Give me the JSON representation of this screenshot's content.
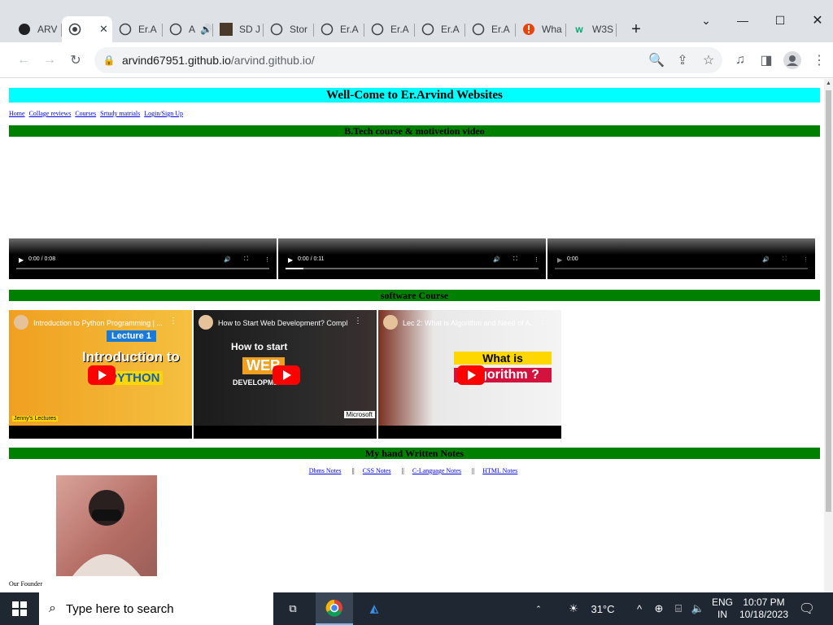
{
  "browser": {
    "tabs": [
      {
        "label": "ARV",
        "icon": "github-icon"
      },
      {
        "label": "",
        "icon": "globe-icon",
        "active": true
      },
      {
        "label": "Er.A",
        "icon": "globe-icon"
      },
      {
        "label": "A",
        "icon": "globe-icon"
      },
      {
        "label": "SD J",
        "icon": "app-icon"
      },
      {
        "label": "Stor",
        "icon": "globe-icon"
      },
      {
        "label": "Er.A",
        "icon": "globe-icon"
      },
      {
        "label": "Er.A",
        "icon": "globe-icon"
      },
      {
        "label": "Er.A",
        "icon": "globe-icon"
      },
      {
        "label": "Er.A",
        "icon": "globe-icon"
      },
      {
        "label": "Wha",
        "icon": "alert-icon"
      },
      {
        "label": "W3S",
        "icon": "w3schools-icon"
      }
    ],
    "url_host": "arvind67951.github.io",
    "url_path": "/arvind.github.io/"
  },
  "page": {
    "title": "Well-Come to Er.Arvind Websites",
    "nav": [
      "Home",
      "Collage reviews",
      "Courses",
      "Srtudy matrials",
      "Login/Sign Up"
    ],
    "section_videos": "B.Tech course & motivetion video",
    "videos": [
      {
        "time": "0:00 / 0:08",
        "progress": 0
      },
      {
        "time": "0:00 / 0:11",
        "progress": 0.07
      },
      {
        "time": "0:00",
        "progress": 0
      }
    ],
    "section_software": "software Course",
    "youtube": [
      {
        "title": "Introduction to Python Programming | ...",
        "big1": "Lecture 1",
        "big2": "Introduction to",
        "big3": "PYTHON",
        "badge": "Jenny's Lectures"
      },
      {
        "title": "How to Start Web Development? Compl...",
        "big1": "How to start",
        "big2": "WEB",
        "big3": "DEVELOPMENT",
        "badge": "Microsoft"
      },
      {
        "title": "Lec 2: What is Algorithm and Need of A...",
        "big1": "What is",
        "big2": "Algorithm ?",
        "big3": "",
        "badge": ""
      }
    ],
    "section_notes": "My hand Written Notes",
    "notes": [
      "Dbms Notes",
      "CSS Notes",
      "C-Language Notes",
      "HTML Notes"
    ],
    "notes_sep": "||",
    "founder_caption": "Our Founder"
  },
  "taskbar": {
    "search_placeholder": "Type here to search",
    "temperature": "31°C",
    "lang1": "ENG",
    "lang2": "IN",
    "time": "10:07 PM",
    "date": "10/18/2023"
  }
}
